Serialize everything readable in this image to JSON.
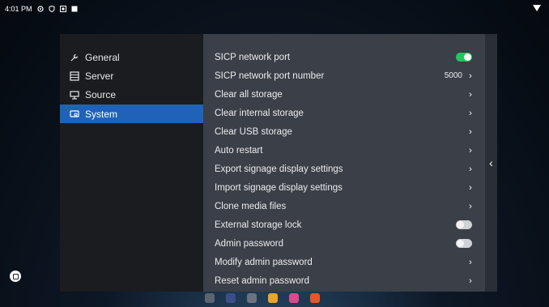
{
  "status_bar": {
    "time": "4:01 PM",
    "icons": [
      "settings-gear-icon",
      "shield-icon",
      "notification-icon",
      "square-icon"
    ],
    "wifi_icon": "wifi-icon"
  },
  "sidebar": {
    "items": [
      {
        "label": "General",
        "icon": "wrench-icon",
        "active": false
      },
      {
        "label": "Server",
        "icon": "server-icon",
        "active": false
      },
      {
        "label": "Source",
        "icon": "source-icon",
        "active": false
      },
      {
        "label": "System",
        "icon": "system-icon",
        "active": true
      }
    ]
  },
  "settings": {
    "rows": [
      {
        "label": "SICP network port",
        "control": "toggle",
        "state": "on"
      },
      {
        "label": "SICP network port number",
        "value": "5000",
        "control": "chevron"
      },
      {
        "label": "Clear all storage",
        "control": "chevron"
      },
      {
        "label": "Clear internal storage",
        "control": "chevron"
      },
      {
        "label": "Clear USB storage",
        "control": "chevron"
      },
      {
        "label": "Auto restart",
        "control": "chevron"
      },
      {
        "label": "Export signage display settings",
        "control": "chevron"
      },
      {
        "label": "Import signage display settings",
        "control": "chevron"
      },
      {
        "label": "Clone media files",
        "control": "chevron"
      },
      {
        "label": "External storage lock",
        "control": "toggle",
        "state": "off"
      },
      {
        "label": "Admin password",
        "control": "toggle",
        "state": "off"
      },
      {
        "label": "Modify admin password",
        "control": "chevron"
      },
      {
        "label": "Reset admin password",
        "control": "chevron"
      }
    ],
    "chevron_glyph": "›"
  },
  "collapse_glyph": "‹",
  "colors": {
    "accent": "#1f63b8",
    "toggle_on": "#22c55e",
    "panel_right": "#3a3f48",
    "panel_left": "#1a1c20"
  }
}
